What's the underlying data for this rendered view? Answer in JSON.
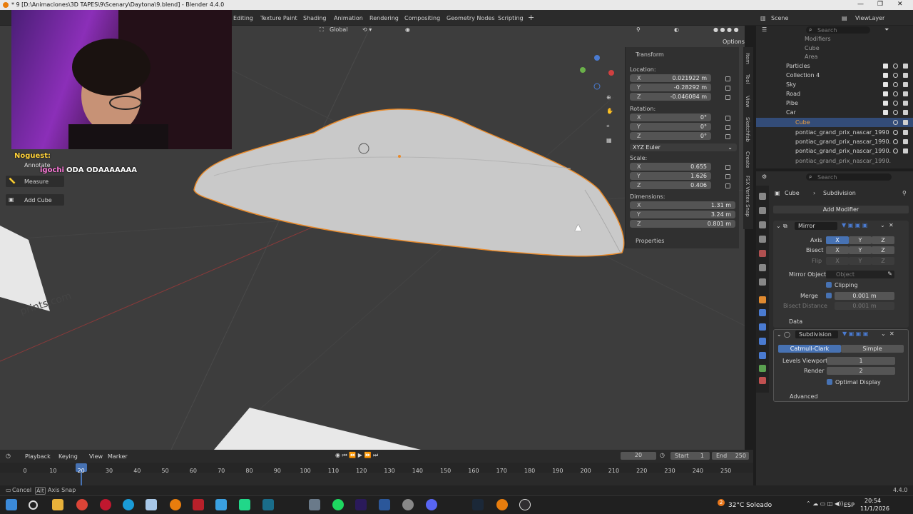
{
  "window": {
    "title": "* 9 [D:\\Animaciones\\3D TAPES\\9\\Scenary\\Daytona\\9.blend] - Blender 4.4.0"
  },
  "workspaces": [
    "Editing",
    "Texture Paint",
    "Shading",
    "Animation",
    "Rendering",
    "Compositing",
    "Geometry Nodes",
    "Scripting"
  ],
  "header": {
    "orientation": "Global",
    "scene": "Scene",
    "view_layer": "ViewLayer",
    "options": "Options"
  },
  "transform": {
    "title": "Transform",
    "location_label": "Location:",
    "location": {
      "x": "0.021922 m",
      "y": "-0.28292 m",
      "z": "-0.046084 m"
    },
    "rotation_label": "Rotation:",
    "rotation": {
      "x": "0°",
      "y": "0°",
      "z": "0°"
    },
    "rotation_mode": "XYZ Euler",
    "scale_label": "Scale:",
    "scale": {
      "x": "0.655",
      "y": "1.626",
      "z": "0.406"
    },
    "dimensions_label": "Dimensions:",
    "dimensions": {
      "x": "1.31 m",
      "y": "3.24 m",
      "z": "0.801 m"
    },
    "properties": "Properties",
    "axis_x": "X",
    "axis_y": "Y",
    "axis_z": "Z"
  },
  "side_tabs": [
    "Item",
    "Tool",
    "View",
    "Sketchfab",
    "Create",
    "FSX Vertex Snap"
  ],
  "outliner": {
    "search_placeholder": "Search",
    "rows": [
      {
        "name": "Modifiers"
      },
      {
        "name": "Cube"
      },
      {
        "name": "Area"
      },
      {
        "name": "Particles"
      },
      {
        "name": "Collection 4"
      },
      {
        "name": "Sky"
      },
      {
        "name": "Road"
      },
      {
        "name": "Pibe"
      },
      {
        "name": "Car"
      },
      {
        "name": "Cube"
      },
      {
        "name": "pontiac_grand_prix_nascar_1990"
      },
      {
        "name": "pontiac_grand_prix_nascar_1990."
      },
      {
        "name": "pontiac_grand_prix_nascar_1990."
      },
      {
        "name": "pontiac_grand_prix_nascar_1990."
      }
    ]
  },
  "properties": {
    "search_placeholder": "Search",
    "object": "Cube",
    "modifier_breadcrumb": "Subdivision",
    "add_modifier": "Add Modifier",
    "mirror": {
      "name": "Mirror",
      "axis_label": "Axis",
      "bisect_label": "Bisect",
      "flip_label": "Flip",
      "x": "X",
      "y": "Y",
      "z": "Z",
      "mirror_object_label": "Mirror Object",
      "mirror_object_placeholder": "Object",
      "clipping": "Clipping",
      "merge_label": "Merge",
      "merge_value": "0.001 m",
      "bisect_distance_label": "Bisect Distance",
      "bisect_distance_value": "0.001 m",
      "data": "Data"
    },
    "subdivision": {
      "name": "Subdivision",
      "catmull": "Catmull-Clark",
      "simple": "Simple",
      "levels_viewport_label": "Levels Viewport",
      "levels_viewport": "1",
      "render_label": "Render",
      "render": "2",
      "optimal_display": "Optimal Display",
      "advanced": "Advanced"
    }
  },
  "toolbar_popup": {
    "annotate": "Annotate",
    "measure": "Measure",
    "add_cube": "Add Cube"
  },
  "chat": {
    "user1": "Noguest:",
    "user2": "igochi",
    "message": "ODA ODAAAAAAA"
  },
  "timeline": {
    "menus": [
      "Playback",
      "Keying",
      "View",
      "Marker"
    ],
    "current_frame": "20",
    "start_label": "Start",
    "start": "1",
    "end_label": "End",
    "end": "250",
    "ticks": [
      "0",
      "10",
      "20",
      "30",
      "40",
      "50",
      "60",
      "70",
      "80",
      "90",
      "100",
      "110",
      "120",
      "130",
      "140",
      "150",
      "160",
      "170",
      "180",
      "190",
      "200",
      "210",
      "220",
      "230",
      "240",
      "250"
    ]
  },
  "status": {
    "cancel": "Cancel",
    "alt": "Alt",
    "axis_snap": "Axis Snap",
    "version": "4.4.0"
  },
  "taskbar": {
    "weather": "32°C  Soleado",
    "lang": "ESP",
    "time": "20:54",
    "date": "11/1/2026",
    "badge": "2"
  },
  "watermark_text": "prints.com"
}
